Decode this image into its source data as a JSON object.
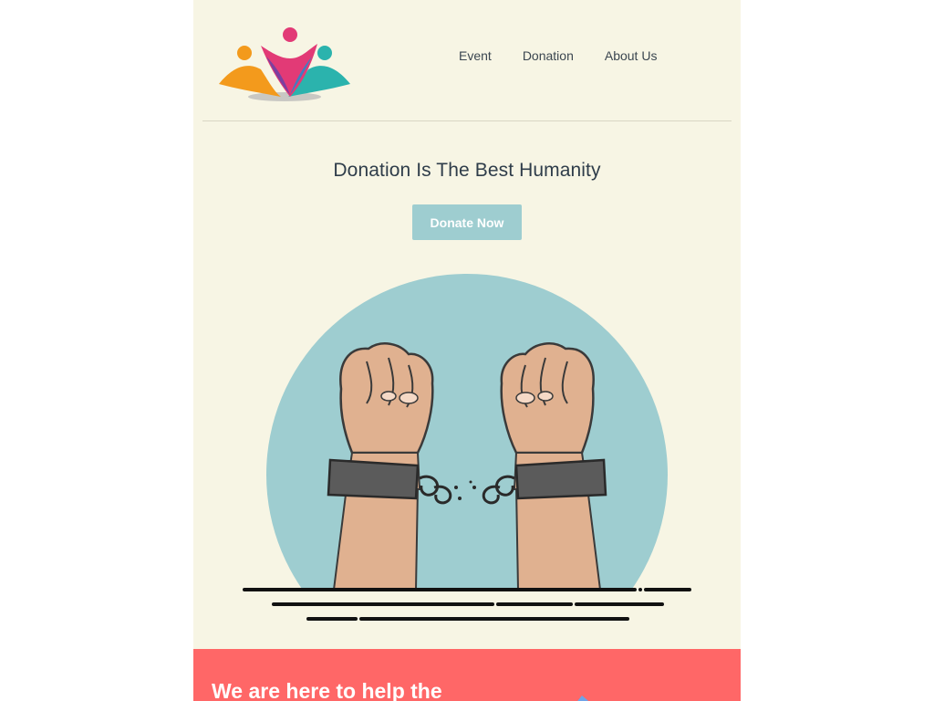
{
  "nav": {
    "items": [
      "Event",
      "Donation",
      "About Us"
    ]
  },
  "hero": {
    "title": "Donation Is The Best Humanity",
    "cta_label": "Donate Now"
  },
  "banner": {
    "heading": "We are here to help the"
  },
  "colors": {
    "page_background": "#f7f5e4",
    "accent_button": "#9ecdd0",
    "illustration_circle": "#9ecdd0",
    "banner_background": "#ff6767",
    "text_dark": "#2f3d4a"
  },
  "icons": {
    "logo": "people-circle-logo",
    "illustration": "broken-handcuffs-fists"
  }
}
